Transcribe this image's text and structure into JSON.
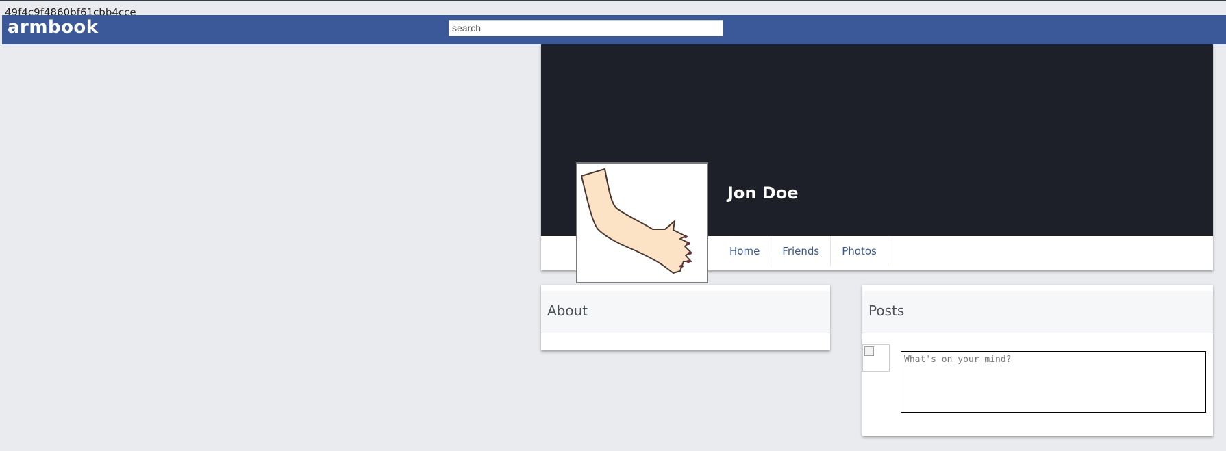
{
  "page": {
    "hash_text": "49f4c9f4860bf61cbb4cce"
  },
  "topbar": {
    "brand": "armbook",
    "search_placeholder": "search"
  },
  "profile": {
    "name": "Jon Doe",
    "avatar_icon": "arm-hand-image",
    "nav": [
      {
        "label": "Home"
      },
      {
        "label": "Friends"
      },
      {
        "label": "Photos"
      }
    ]
  },
  "about": {
    "title": "About"
  },
  "posts": {
    "title": "Posts",
    "composer_placeholder": "What's on your mind?"
  },
  "colors": {
    "brand_blue": "#3b5998",
    "cover": "#1e2029",
    "page_bg": "#e9ebee",
    "link": "#365899"
  }
}
